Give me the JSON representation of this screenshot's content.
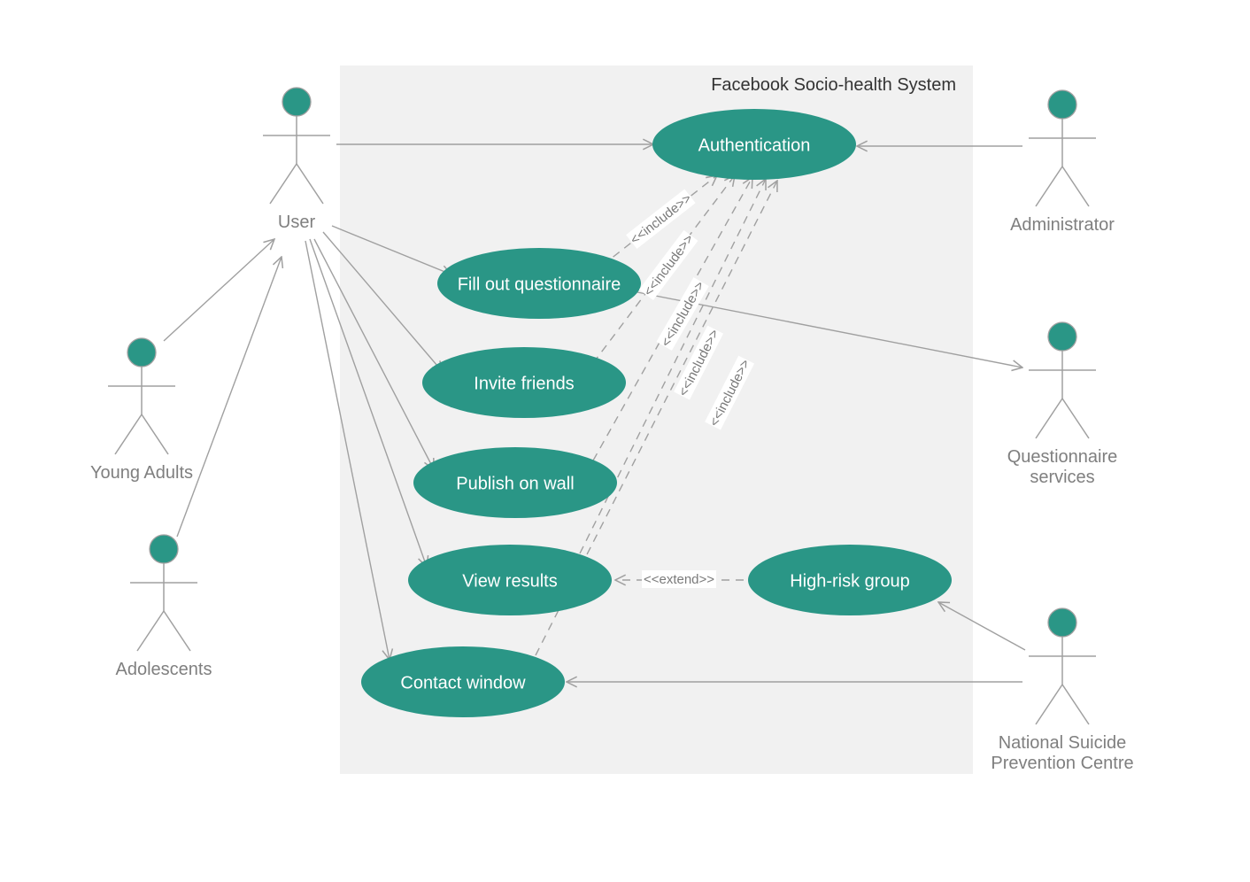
{
  "diagram": {
    "systemTitle": "Facebook Socio-health System",
    "colors": {
      "accent": "#2A9686",
      "actorStroke": "#A0A0A0",
      "systemFill": "#F1F1F1"
    },
    "actors": {
      "user": "User",
      "youngAdults": "Young Adults",
      "adolescents": "Adolescents",
      "administrator": "Administrator",
      "questionnaireServices": "Questionnaire",
      "questionnaireServices2": "services",
      "nspc1": "National Suicide",
      "nspc2": "Prevention Centre"
    },
    "usecases": {
      "authentication": "Authentication",
      "fillQuestionnaire": "Fill out questionnaire",
      "inviteFriends": "Invite friends",
      "publishWall": "Publish on wall",
      "viewResults": "View results",
      "contactWindow": "Contact window",
      "highRisk": "High-risk group"
    },
    "relLabels": {
      "include": "<<include>>",
      "extend": "<<extend>>"
    }
  }
}
